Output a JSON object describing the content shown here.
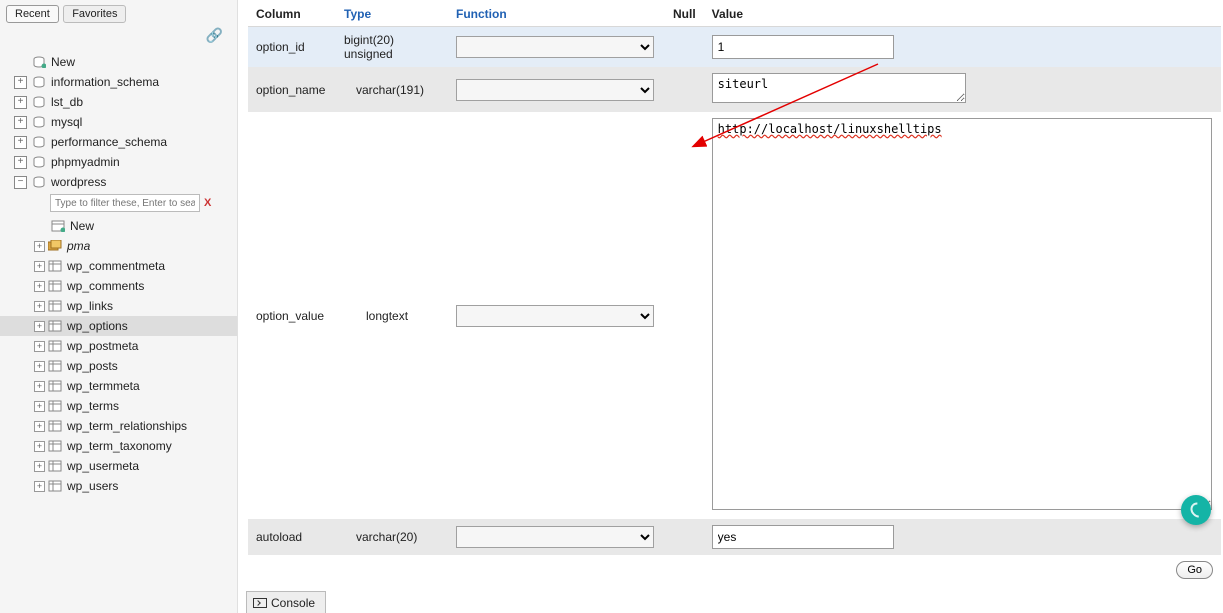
{
  "sidebar": {
    "tabs": {
      "recent": "Recent",
      "favorites": "Favorites"
    },
    "nav_new": "New",
    "databases": [
      {
        "name": "information_schema"
      },
      {
        "name": "lst_db"
      },
      {
        "name": "mysql"
      },
      {
        "name": "performance_schema"
      },
      {
        "name": "phpmyadmin"
      },
      {
        "name": "wordpress",
        "expanded": true
      }
    ],
    "filter_placeholder": "Type to filter these, Enter to search all",
    "filter_clear": "X",
    "wordpress_new": "New",
    "wordpress_tables": [
      {
        "name": "pma",
        "italic": true,
        "special": true
      },
      {
        "name": "wp_commentmeta"
      },
      {
        "name": "wp_comments"
      },
      {
        "name": "wp_links"
      },
      {
        "name": "wp_options",
        "selected": true
      },
      {
        "name": "wp_postmeta"
      },
      {
        "name": "wp_posts"
      },
      {
        "name": "wp_termmeta"
      },
      {
        "name": "wp_terms"
      },
      {
        "name": "wp_term_relationships"
      },
      {
        "name": "wp_term_taxonomy"
      },
      {
        "name": "wp_usermeta"
      },
      {
        "name": "wp_users"
      }
    ]
  },
  "table_headers": {
    "column": "Column",
    "type": "Type",
    "function": "Function",
    "null": "Null",
    "value": "Value"
  },
  "rows": {
    "option_id": {
      "column": "option_id",
      "type": "bigint(20) unsigned",
      "value": "1"
    },
    "option_name": {
      "column": "option_name",
      "type": "varchar(191)",
      "value": "siteurl"
    },
    "option_value": {
      "column": "option_value",
      "type": "longtext",
      "value": "http://localhost/linuxshelltips"
    },
    "autoload": {
      "column": "autoload",
      "type": "varchar(20)",
      "value": "yes"
    }
  },
  "go_button": "Go",
  "console_label": "Console"
}
